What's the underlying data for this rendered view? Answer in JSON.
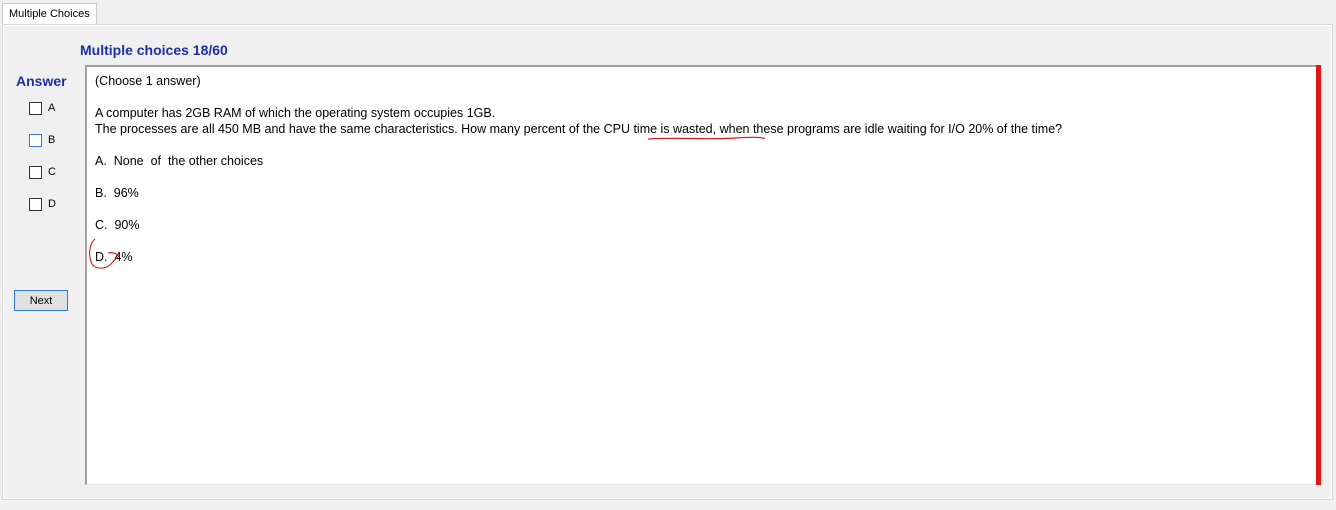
{
  "tab": {
    "label": "Multiple Choices"
  },
  "header": {
    "title": "Multiple choices 18/60"
  },
  "answer_panel": {
    "label": "Answer",
    "options": [
      {
        "label": "A",
        "checked": false
      },
      {
        "label": "B",
        "checked": false,
        "focused": true
      },
      {
        "label": "C",
        "checked": false
      },
      {
        "label": "D",
        "checked": false
      }
    ],
    "next_label": "Next"
  },
  "question": {
    "instruction": "(Choose 1 answer)",
    "stem_line1": "A computer has 2GB RAM of which the operating system occupies 1GB.",
    "stem_line2": "The processes are all 450 MB and have the same characteristics. How many percent of the CPU time is wasted, when these programs are idle waiting for I/O 20% of the time?",
    "choices": [
      "A.  None  of  the other choices",
      "B.  96%",
      "C.  90%",
      "D.  4%"
    ]
  },
  "colors": {
    "title": "#1a2fa8",
    "scrollbar_accent": "#e41414",
    "annotation": "#d01818"
  }
}
